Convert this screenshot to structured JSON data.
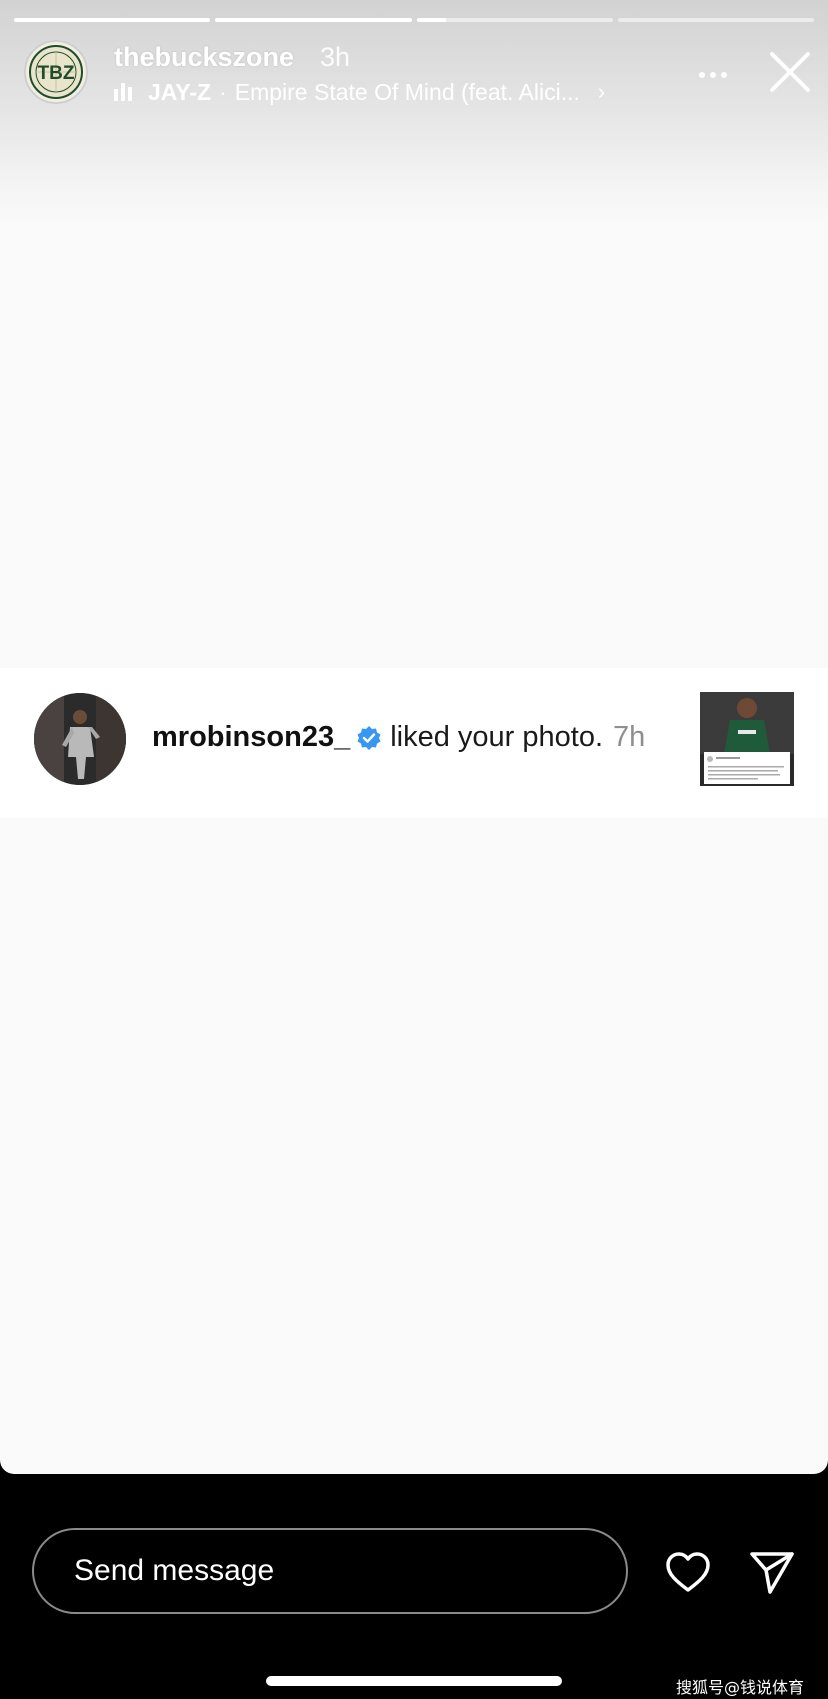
{
  "story": {
    "progress": [
      1.0,
      1.0,
      0.15,
      0.0
    ],
    "account": {
      "username": "thebuckszone",
      "avatar_text": "TBZ",
      "time_ago": "3h"
    },
    "music": {
      "icon": "music-bars-icon",
      "artist": "JAY-Z",
      "separator": "·",
      "title": "Empire State Of Mind (feat. Alici...",
      "chevron": "›"
    },
    "more_icon": "more-dots-icon",
    "close_icon": "close-icon"
  },
  "notification": {
    "username": "mrobinson23_",
    "verified_icon": "verified-badge-icon",
    "action": "liked your photo.",
    "time": "7h"
  },
  "composer": {
    "placeholder": "Send message",
    "heart_icon": "heart-icon",
    "share_icon": "paper-plane-icon"
  },
  "watermark": "搜狐号@钱说体育",
  "colors": {
    "verified": "#3897f0",
    "card_background": "#fafafa",
    "bottom_background": "#000000"
  }
}
